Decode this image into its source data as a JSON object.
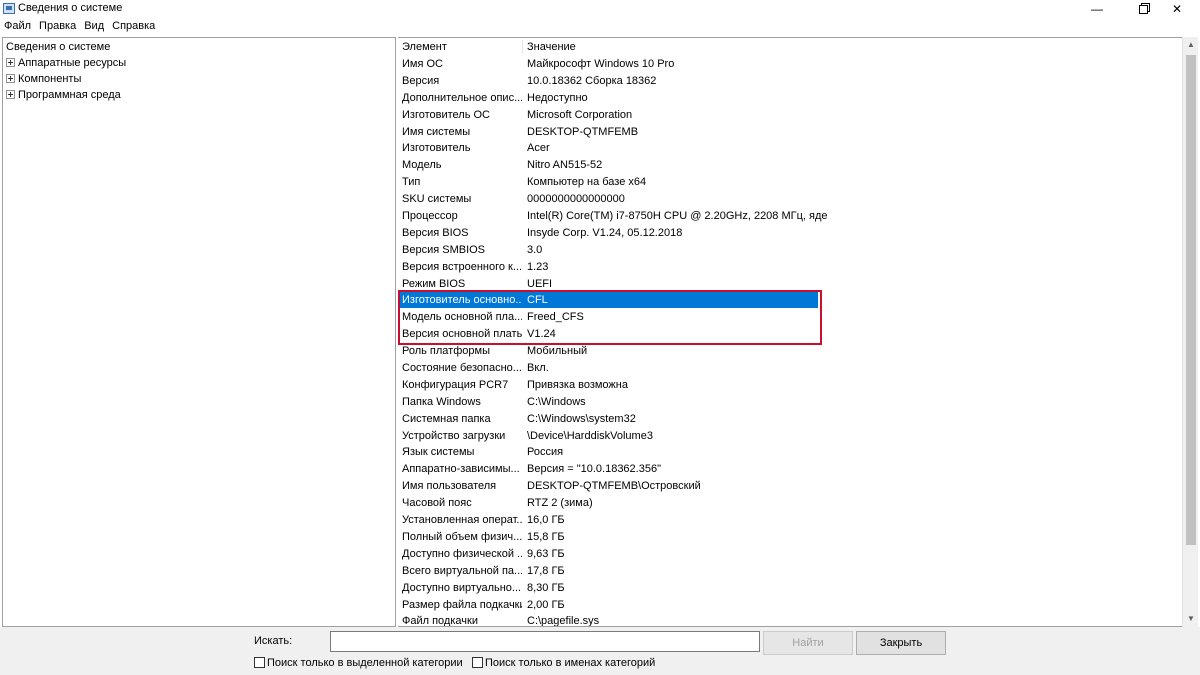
{
  "window": {
    "title": "Сведения о системе",
    "minimize": "—",
    "close": "✕"
  },
  "menu": [
    "Файл",
    "Правка",
    "Вид",
    "Справка"
  ],
  "tree": {
    "root": "Сведения о системе",
    "items": [
      "Аппаратные ресурсы",
      "Компоненты",
      "Программная среда"
    ]
  },
  "list": {
    "columns": [
      "Элемент",
      "Значение"
    ],
    "rows": [
      [
        "Имя ОС",
        "Майкрософт Windows 10 Pro"
      ],
      [
        "Версия",
        "10.0.18362 Сборка 18362"
      ],
      [
        "Дополнительное опис...",
        "Недоступно"
      ],
      [
        "Изготовитель ОС",
        "Microsoft Corporation"
      ],
      [
        "Имя системы",
        "DESKTOP-QTMFEMB"
      ],
      [
        "Изготовитель",
        "Acer"
      ],
      [
        "Модель",
        "Nitro AN515-52"
      ],
      [
        "Тип",
        "Компьютер на базе x64"
      ],
      [
        "SKU системы",
        "0000000000000000"
      ],
      [
        "Процессор",
        "Intel(R) Core(TM) i7-8750H CPU @ 2.20GHz, 2208 МГц, яде..."
      ],
      [
        "Версия BIOS",
        "Insyde Corp. V1.24, 05.12.2018"
      ],
      [
        "Версия SMBIOS",
        "3.0"
      ],
      [
        "Версия встроенного к...",
        "1.23"
      ],
      [
        "Режим BIOS",
        "UEFI"
      ],
      [
        "Изготовитель основно...",
        "CFL"
      ],
      [
        "Модель основной пла...",
        "Freed_CFS"
      ],
      [
        "Версия основной платы",
        "V1.24"
      ],
      [
        "Роль платформы",
        "Мобильный"
      ],
      [
        "Состояние безопасно...",
        "Вкл."
      ],
      [
        "Конфигурация PCR7",
        "Привязка возможна"
      ],
      [
        "Папка Windows",
        "C:\\Windows"
      ],
      [
        "Системная папка",
        "C:\\Windows\\system32"
      ],
      [
        "Устройство загрузки",
        "\\Device\\HarddiskVolume3"
      ],
      [
        "Язык системы",
        "Россия"
      ],
      [
        "Аппаратно-зависимы...",
        "Версия = \"10.0.18362.356\""
      ],
      [
        "Имя пользователя",
        "DESKTOP-QTMFEMB\\Островский"
      ],
      [
        "Часовой пояс",
        "RTZ 2 (зима)"
      ],
      [
        "Установленная операт...",
        "16,0 ГБ"
      ],
      [
        "Полный объем физич...",
        "15,8 ГБ"
      ],
      [
        "Доступно физической ...",
        "9,63 ГБ"
      ],
      [
        "Всего виртуальной па...",
        "17,8 ГБ"
      ],
      [
        "Доступно виртуально...",
        "8,30 ГБ"
      ],
      [
        "Размер файла подкачки",
        "2,00 ГБ"
      ],
      [
        "Файл подкачки",
        "C:\\pagefile.sys"
      ]
    ],
    "selected_index": 14
  },
  "search": {
    "label": "Искать:",
    "value": "",
    "find_button": "Найти",
    "close_button": "Закрыть",
    "checkbox1": "Поиск только в выделенной категории",
    "checkbox2": "Поиск только в именах категорий"
  },
  "colors": {
    "selection": "#0078d7",
    "highlight_box": "#c8102e"
  }
}
